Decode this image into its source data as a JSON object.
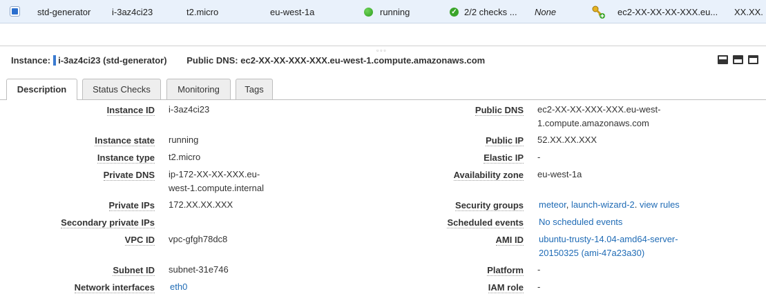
{
  "instance_row": {
    "name": "std-generator",
    "instance_id": "i-3az4ci23",
    "instance_type": "t2.micro",
    "availability_zone": "eu-west-1a",
    "state": "running",
    "status_checks": "2/2 checks ...",
    "alarm_status": "None",
    "public_dns": "ec2-XX-XX-XX-XXX.eu...",
    "public_ip": "XX.XX."
  },
  "header": {
    "instance_label": "Instance:",
    "instance_value": "i-3az4ci23 (std-generator)",
    "dns_label": "Public DNS:",
    "dns_value": "ec2-XX-XX-XXX-XXX.eu-west-1.compute.amazonaws.com"
  },
  "tabs": [
    "Description",
    "Status Checks",
    "Monitoring",
    "Tags"
  ],
  "left_fields": [
    {
      "label": "Instance ID",
      "value": "i-3az4ci23"
    },
    {
      "label": "Instance state",
      "value": "running"
    },
    {
      "label": "Instance type",
      "value": "t2.micro"
    },
    {
      "label": "Private DNS",
      "value": "ip-172-XX-XX-XXX.eu-west-1.compute.internal"
    },
    {
      "label": "Private IPs",
      "value": "172.XX.XX.XXX"
    },
    {
      "label": "Secondary private IPs",
      "value": ""
    },
    {
      "label": "VPC ID",
      "value": "vpc-gfgh78dc8"
    },
    {
      "label": "Subnet ID",
      "value": "subnet-31e746"
    },
    {
      "label": "Network interfaces",
      "value": "eth0"
    }
  ],
  "right_fields": [
    {
      "label": "Public DNS",
      "value": "ec2-XX-XX-XXX-XXX.eu-west-1.compute.amazonaws.com"
    },
    {
      "label": "Public IP",
      "value": "52.XX.XX.XXX"
    },
    {
      "label": "Elastic IP",
      "value": "-"
    },
    {
      "label": "Availability zone",
      "value": "eu-west-1a"
    },
    {
      "label": "Security groups",
      "links": [
        "meteor",
        "launch-wizard-2"
      ],
      "sep1": ",",
      "sep2": ".",
      "extra_link": "view rules"
    },
    {
      "label": "Scheduled events",
      "value": "No scheduled events"
    },
    {
      "label": "AMI ID",
      "value": "ubuntu-trusty-14.04-amd64-server-20150325 (ami-47a23a30)"
    },
    {
      "label": "Platform",
      "value": "-"
    },
    {
      "label": "IAM role",
      "value": "-"
    }
  ]
}
